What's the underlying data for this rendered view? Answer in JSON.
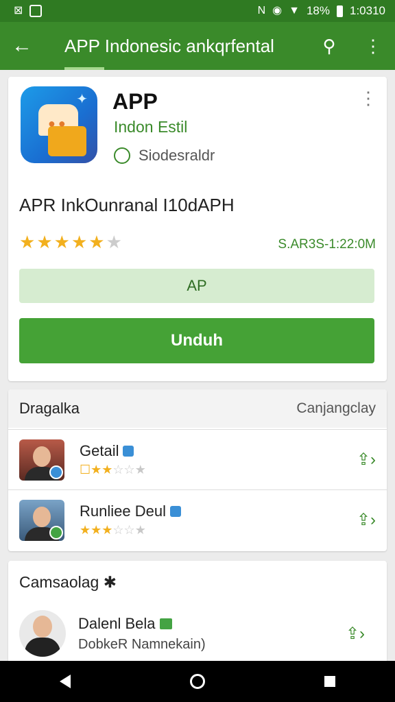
{
  "status_bar": {
    "time": "1:0310",
    "battery": "18%",
    "icons": [
      "photo-icon",
      "image-icon",
      "nfc-icon",
      "alarm-icon",
      "wifi-icon",
      "battery-icon"
    ]
  },
  "app_bar": {
    "title": "APP Indonesic ankqrfental",
    "icons": [
      "back-arrow-icon",
      "search-icon",
      "more-vertical-icon"
    ]
  },
  "app": {
    "name": "APP",
    "developer": "Indon Estil",
    "category": "Siodesraldr",
    "tagline": "APR  InkOunranal I10dAPH",
    "rating_stars": 5,
    "meta": "S.AR3S-1:22:0M",
    "secondary_button": "AP",
    "install_button": "Unduh"
  },
  "list_section": {
    "title": "Dragalka",
    "link": "Canjangclay",
    "items": [
      {
        "title": "Getail",
        "rating": 2.5
      },
      {
        "title": "Runliee Deul",
        "rating": 2.5
      }
    ]
  },
  "related_section": {
    "title": "Camsaolag",
    "item": {
      "title": "Dalenl Bela",
      "subtitle": "DobkeR Namnekain)"
    }
  },
  "colors": {
    "primary": "#3a8a2a",
    "primary_dark": "#2f7a22",
    "button": "#45a236",
    "button_light": "#d6ecd0",
    "star": "#f2b01e"
  }
}
